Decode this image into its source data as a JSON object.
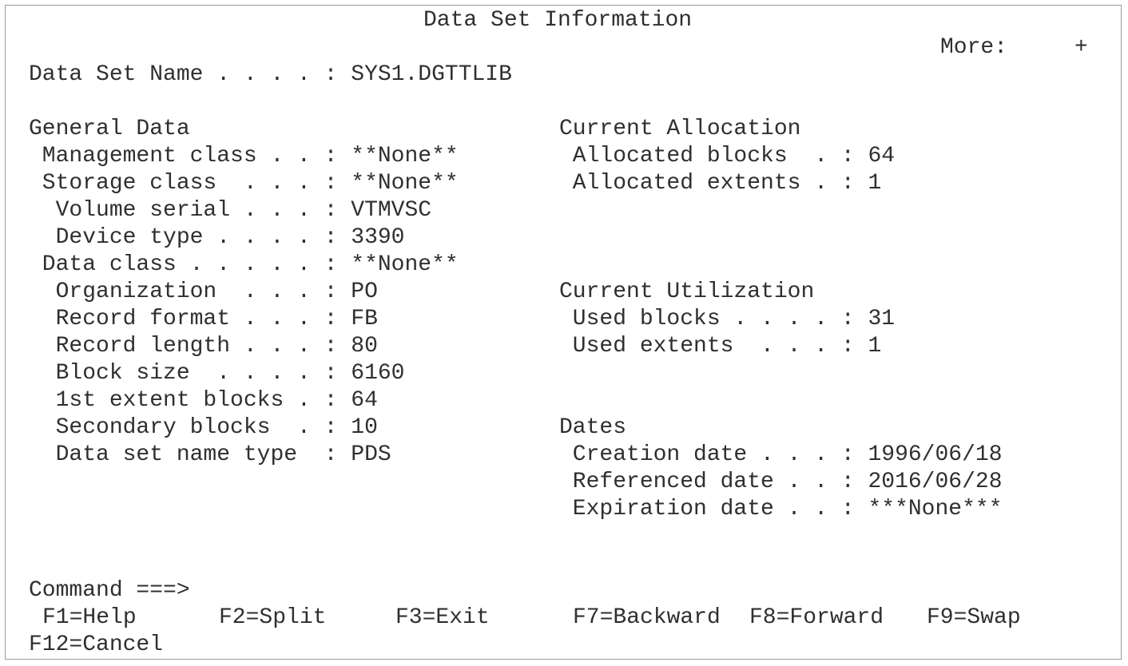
{
  "title": "Data Set Information",
  "more": "More:     +",
  "dsname_line": "Data Set Name . . . . : SYS1.DGTTLIB",
  "general": {
    "heading": "General Data",
    "rows": [
      " Management class . . : **None**",
      " Storage class  . . . : **None**",
      "  Volume serial . . . : VTMVSC",
      "  Device type . . . . : 3390",
      " Data class . . . . . : **None**",
      "  Organization  . . . : PO",
      "  Record format . . . : FB",
      "  Record length . . . : 80",
      "  Block size  . . . . : 6160",
      "  1st extent blocks . : 64",
      "  Secondary blocks  . : 10",
      "  Data set name type  : PDS"
    ]
  },
  "allocation": {
    "heading": "Current Allocation",
    "rows": [
      " Allocated blocks  . : 64",
      " Allocated extents . : 1"
    ]
  },
  "utilization": {
    "heading": "Current Utilization",
    "rows": [
      " Used blocks . . . . : 31",
      " Used extents  . . . : 1"
    ]
  },
  "dates": {
    "heading": "Dates",
    "rows": [
      " Creation date . . . : 1996/06/18",
      " Referenced date . . : 2016/06/28",
      " Expiration date . . : ***None***"
    ]
  },
  "command": {
    "label": "Command ===>",
    "value": ""
  },
  "fkeys": {
    "help": "F1=Help",
    "split": "F2=Split",
    "exit": "F3=Exit",
    "backward": "F7=Backward",
    "forward": "F8=Forward",
    "swap": "F9=Swap",
    "cancel": "F12=Cancel"
  }
}
